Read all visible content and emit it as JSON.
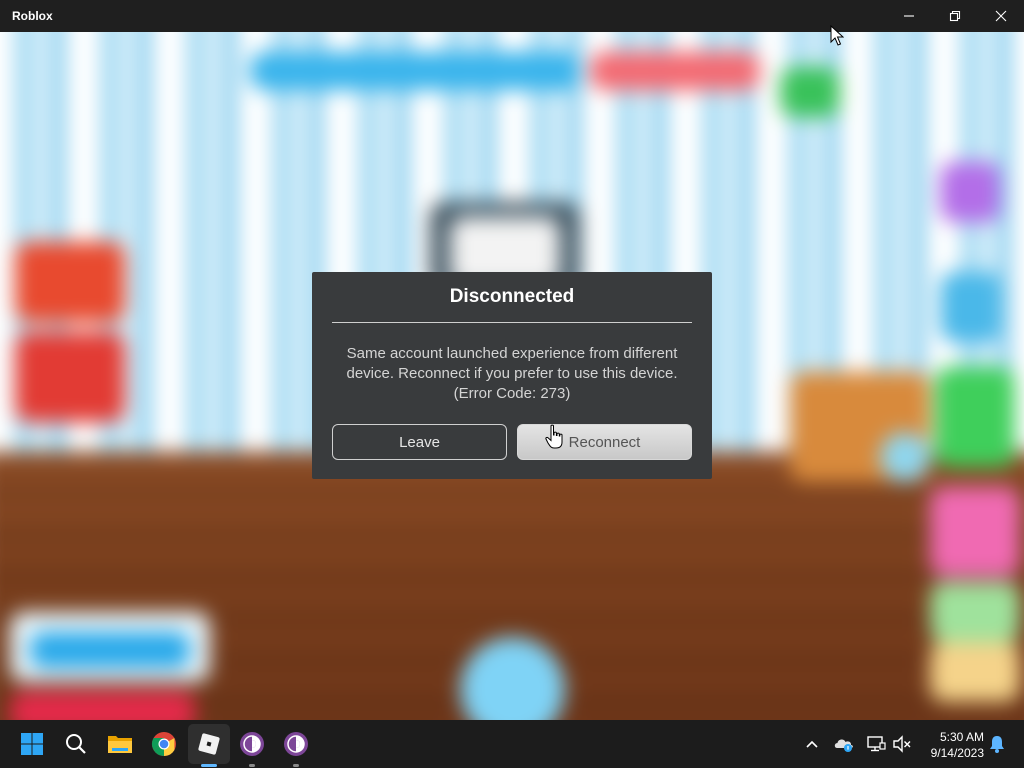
{
  "window": {
    "title": "Roblox",
    "minimize_icon": "minimize-icon",
    "maximize_icon": "restore-icon",
    "close_icon": "close-icon"
  },
  "dialog": {
    "title": "Disconnected",
    "message_line1": "Same account launched experience from different",
    "message_line2": "device.  Reconnect if you prefer to use this device.",
    "message_line3": "(Error Code: 273)",
    "leave_label": "Leave",
    "reconnect_label": "Reconnect"
  },
  "taskbar": {
    "apps": [
      "start-icon",
      "search-icon",
      "file-explorer-icon",
      "chrome-icon",
      "roblox-icon",
      "tor-browser-icon",
      "tor-browser-icon"
    ],
    "tray": [
      "chevron-up-icon",
      "onedrive-icon",
      "network-icon",
      "speaker-muted-icon",
      "notification-bell-icon"
    ],
    "time": "5:30 AM",
    "date": "9/14/2023"
  },
  "colors": {
    "dialog_bg": "#393b3d",
    "titlebar_bg": "#1f1f1f",
    "taskbar_bg": "#1c1c1c",
    "windows_blue": "#2ea6f5"
  }
}
